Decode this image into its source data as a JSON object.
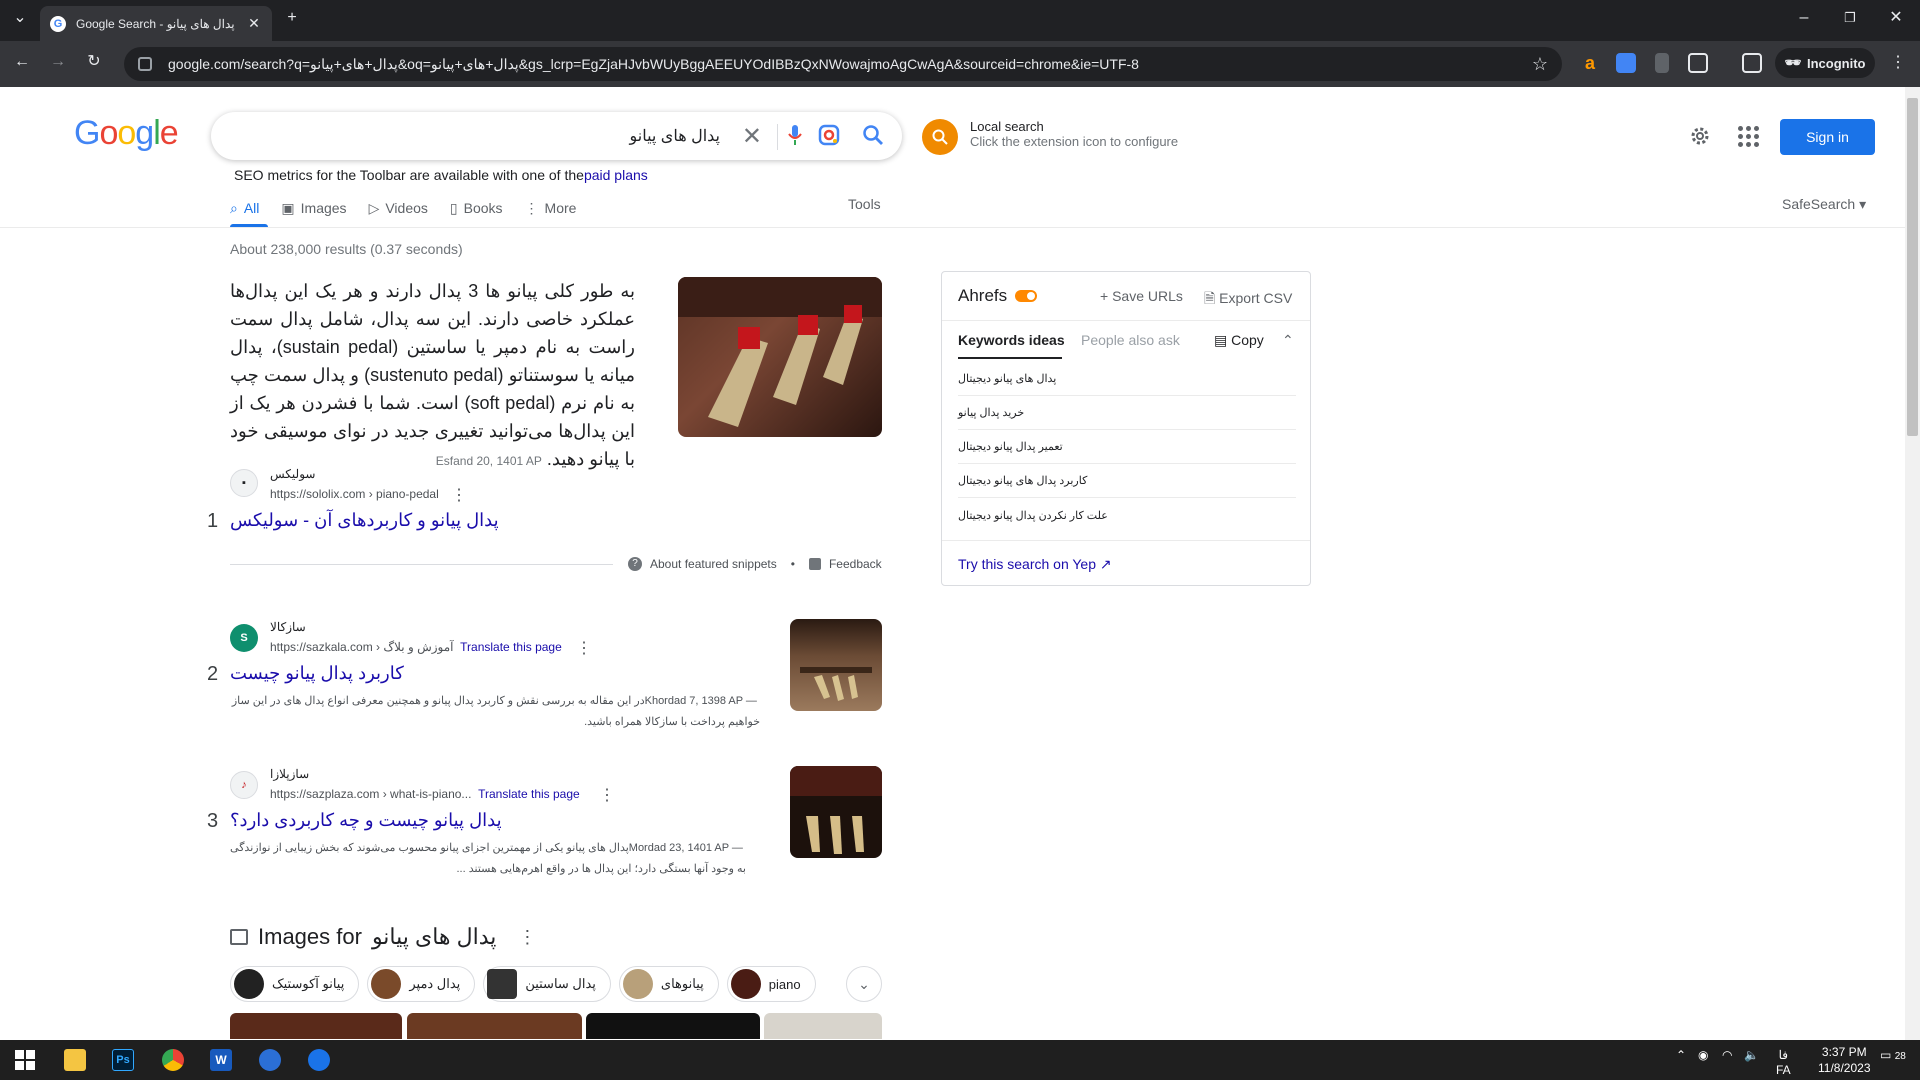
{
  "browser": {
    "tab_title": "Google Search - پدال های پیانو",
    "url": "google.com/search?q=پدال+های+پیانو&oq=پدال+های+پیانو&gs_lcrp=EgZjaHJvbWUyBggAEEUYOdIBBzQxNWowajmoAgCwAgA&sourceid=chrome&ie=UTF-8",
    "incognito_label": "Incognito"
  },
  "google": {
    "logo": [
      "G",
      "o",
      "o",
      "g",
      "l",
      "e"
    ],
    "query": "پدال های پیانو",
    "local_search": {
      "title": "Local search",
      "subtitle": "Click the extension icon to configure"
    },
    "sign_in": "Sign in",
    "seo_text": "SEO metrics for the Toolbar are available with one of the",
    "seo_link": "paid plans",
    "nav": {
      "all": "All",
      "images": "Images",
      "videos": "Videos",
      "books": "Books",
      "more": "More",
      "tools": "Tools",
      "safesearch": "SafeSearch"
    },
    "stats": "About 238,000 results (0.37 seconds)"
  },
  "snippet": {
    "text": "به طور کلی پیانو ها 3 پدال دارند و هر یک این پدال‌ها عملکرد خاصی دارند. این سه پدال، شامل پدال سمت راست به نام دمپر یا ساستین (sustain pedal)، پدال میانه یا سوستناتو (sustenuto pedal) و پدال سمت چپ به نام نرم (soft pedal) است. شما با فشردن هر یک از این پدال‌ها می‌توانید تغییری جدید در نوای موسیقی خود با پیانو دهید.",
    "date": "Esfand 20, 1401 AP",
    "about": "About featured snippets",
    "feedback": "Feedback"
  },
  "results": [
    {
      "num": "1",
      "site": "سولیکس",
      "url": "https://sololix.com › piano-pedal",
      "translate": "",
      "title": "پدال پیانو و کاربردهای آن - سولیکس",
      "date": "",
      "snippet": ""
    },
    {
      "num": "2",
      "site": "سازکالا",
      "url": "https://sazkala.com › آموزش و بلاگ",
      "translate": "Translate this page",
      "title": "کاربرد پدال پیانو چیست",
      "date": "Khordad 7, 1398 AP — ",
      "snippet": "در این مقاله به بررسی نقش و کاربرد پدال پیانو و همچنین معرفی انواع پدال های در این ساز خواهیم پرداخت با سازکالا همراه باشید."
    },
    {
      "num": "3",
      "site": "سازپلازا",
      "url": "https://sazplaza.com › what-is-piano...",
      "translate": "Translate this page",
      "title": "پدال پیانو چیست و چه کاربردی دارد؟",
      "date": "Mordad 23, 1401 AP — ",
      "snippet": "پدال های پیانو یکی از مهمترین اجزای پیانو محسوب می‌شوند که بخش زیبایی از نوازندگی به وجود آنها بستگی دارد؛ این پدال ها در واقع اهرم‌هایی هستند ..."
    }
  ],
  "images_for": {
    "label": "Images for",
    "query": "پدال های پیانو",
    "chips": [
      "پیانو آکوستیک",
      "پدال دمپر",
      "پدال ساستین",
      "پیانوهای",
      "piano"
    ]
  },
  "ahrefs": {
    "title": "Ahrefs",
    "save_urls": "+ Save URLs",
    "export_csv": "Export CSV",
    "tab_keywords": "Keywords ideas",
    "tab_people": "People also ask",
    "copy": "Copy",
    "keywords": [
      "پدال های پیانو دیجیتال",
      "خرید پدال پیانو",
      "تعمیر پدال پیانو دیجیتال",
      "کاربرد پدال های پیانو دیجیتال",
      "علت کار نکردن پدال پیانو دیجیتال"
    ],
    "yep": "Try this search on Yep"
  },
  "taskbar": {
    "lang_top": "فا",
    "lang": "FA",
    "time": "3:37 PM",
    "date": "11/8/2023",
    "notifications": "28"
  },
  "colors": {
    "accent": "#1a73e8",
    "link": "#1a0dab",
    "chrome_dark": "#202124",
    "ahrefs_orange": "#ff8800"
  }
}
